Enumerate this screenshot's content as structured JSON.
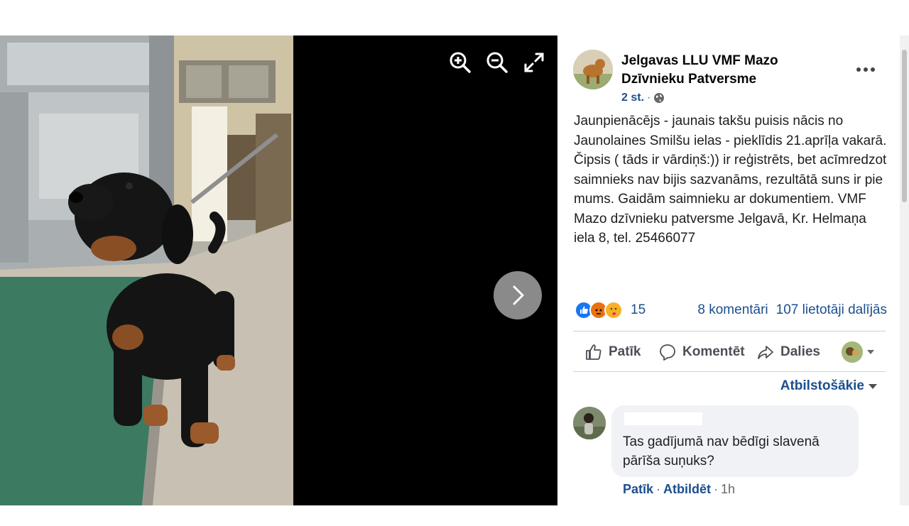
{
  "viewer": {
    "tools": {
      "zoom_in_icon": "zoom-in-icon",
      "zoom_out_icon": "zoom-out-icon",
      "fullscreen_icon": "fullscreen-icon",
      "next_icon": "chevron-right-icon"
    }
  },
  "post": {
    "page_name": "Jelgavas LLU VMF Mazo Dzīvnieku Patversme",
    "time": "2 st.",
    "separator": "·",
    "privacy_icon": "globe-icon",
    "text": "Jaunpienācējs - jaunais takšu puisis nācis no Jaunolaines Smilšu ielas - pieklīdis 21.aprīļa vakarā. Čipsis ( tāds ir vārdiņš:)) ir reģistrēts, bet acīmredzot saimnieks nav bijis sazvanāms, rezultātā suns ir pie mums. Gaidām saimnieku ar dokumentiem. VMF Mazo dzīvnieku patversme Jelgavā, Kr. Helmaņa iela 8, tel. 25466077"
  },
  "reactions": {
    "icons": [
      "like-reaction-icon",
      "angry-reaction-icon",
      "care-reaction-icon"
    ],
    "colors": {
      "like": "#1877f2",
      "angry": "#e9710f",
      "care": "#f7b125"
    },
    "count": "15",
    "comments": "8 komentāri",
    "shares": "107 lietotāji dalījās"
  },
  "actions": {
    "like": "Patīk",
    "comment": "Komentēt",
    "share": "Dalies"
  },
  "relevance": {
    "label": "Atbilstošākie"
  },
  "comment": {
    "text": "Tas gadījumā nav bēdīgi slavenā pārīša suņuks?",
    "like": "Patīk",
    "separator": "·",
    "reply": "Atbildēt",
    "time": "1h"
  }
}
